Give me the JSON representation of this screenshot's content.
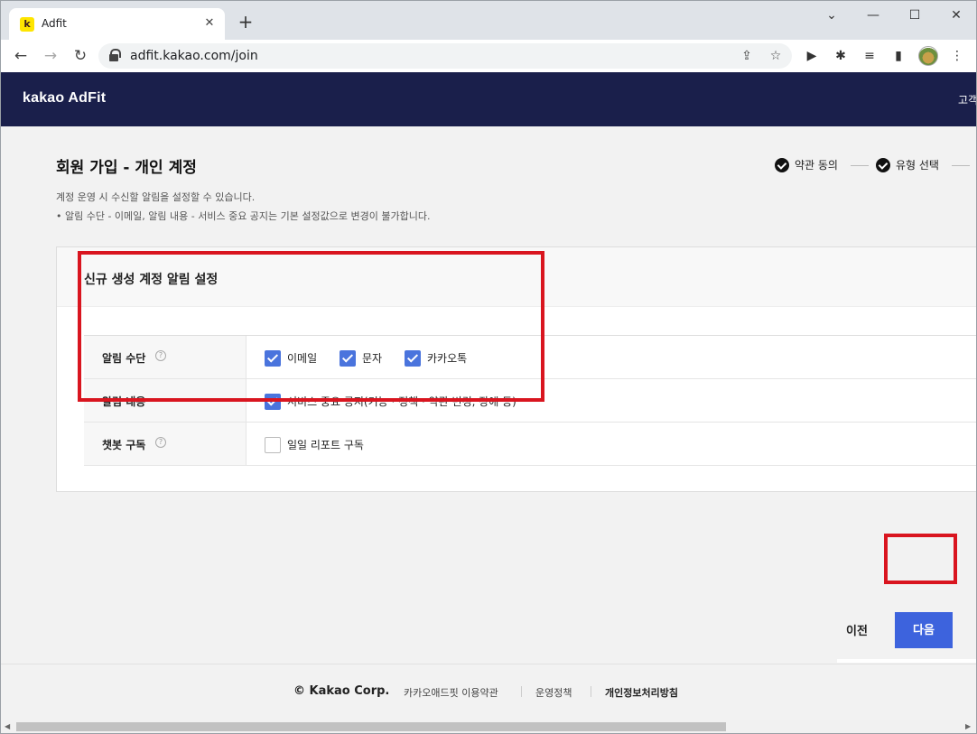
{
  "browser": {
    "tab_title": "Adfit",
    "tab_favicon_letter": "k",
    "url": "adfit.kakao.com/join"
  },
  "header": {
    "logo": "kakao AdFit",
    "right_link": "고객"
  },
  "page": {
    "title": "회원 가입 - 개인 계정",
    "steps": [
      {
        "label": "약관 동의",
        "done": true
      },
      {
        "label": "유형 선택",
        "done": true
      }
    ],
    "description_1": "계정 운영 시 수신할 알림을 설정할 수 있습니다.",
    "description_2": "• 알림 수단 - 이메일, 알림 내용 - 서비스 중요 공지는 기본 설정값으로 변경이 불가합니다."
  },
  "panel": {
    "title": "신규 생성 계정 알림 설정",
    "rows": [
      {
        "label": "알림 수단",
        "help": true,
        "options": [
          {
            "label": "이메일",
            "checked": true
          },
          {
            "label": "문자",
            "checked": true
          },
          {
            "label": "카카오톡",
            "checked": true
          }
        ]
      },
      {
        "label": "알림 내용",
        "help": false,
        "options": [
          {
            "label": "서비스 중요 공지(기능 · 정책 · 약관 변경, 장애 등)",
            "checked": true
          }
        ]
      },
      {
        "label": "챗봇 구독",
        "help": true,
        "options": [
          {
            "label": "일일 리포트 구독",
            "checked": false
          }
        ]
      }
    ]
  },
  "actions": {
    "prev_label": "이전",
    "next_label": "다음"
  },
  "footer": {
    "copyright": "© Kakao Corp.",
    "links": [
      "카카오애드핏 이용약관",
      "운영정책",
      "개인정보처리방침"
    ]
  },
  "colors": {
    "header_bg": "#1a1f4b",
    "accent": "#3d63dd",
    "highlight": "#d9151f"
  }
}
